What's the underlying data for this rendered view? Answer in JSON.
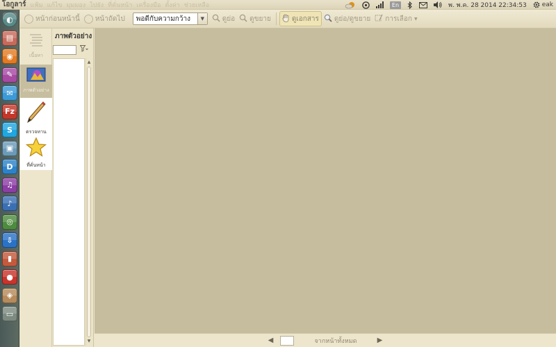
{
  "top_panel": {
    "app_title": "โอกูลาร์",
    "menus": [
      "แฟ้ม",
      "แก้ไข",
      "มุมมอง",
      "ไปยัง",
      "ที่คั่นหน้า",
      "เครื่องมือ",
      "ตั้งค่า",
      "ช่วยเหลือ"
    ],
    "keyboard_layout": "En",
    "datetime": "พ. พ.ค. 28 2014 22:34:53",
    "user": "eak"
  },
  "launcher": {
    "items": [
      {
        "icon": "dash-home-icon",
        "color": "#3d8ad1"
      },
      {
        "icon": "files-icon",
        "color": "#c76a5a"
      },
      {
        "icon": "firefox-icon",
        "color": "#e47a21"
      },
      {
        "icon": "calligra-icon",
        "color": "#a74aa3"
      },
      {
        "icon": "messenger-icon",
        "color": "#3b9ad8"
      },
      {
        "icon": "filezilla-icon",
        "color": "#c4362a"
      },
      {
        "icon": "skype-icon",
        "color": "#20a6e0"
      },
      {
        "icon": "image-viewer-icon",
        "color": "#6b9ab8"
      },
      {
        "icon": "dictionary-icon",
        "color": "#2d83c9"
      },
      {
        "icon": "audio-player-icon",
        "color": "#8b3ea4"
      },
      {
        "icon": "music-icon",
        "color": "#3b6fb3"
      },
      {
        "icon": "disk-icon",
        "color": "#4d8b3e"
      },
      {
        "icon": "downloader-icon",
        "color": "#2a72c6"
      },
      {
        "icon": "terminal-icon",
        "color": "#c45a3c"
      },
      {
        "icon": "media-icon",
        "color": "#c9342c"
      },
      {
        "icon": "okular-icon",
        "color": "#b68a5a"
      },
      {
        "icon": "trash-icon",
        "color": "#7c8a80"
      }
    ]
  },
  "toolbar": {
    "prev_label": "หน้าก่อนหน้านี้",
    "next_label": "หน้าถัดไป",
    "zoom_value": "พอดีกับความกว้าง",
    "zoom_in_label": "ดูย่อ",
    "zoom_out_label": "ดูขยาย",
    "browse_label": "ดูเอกสาร",
    "zoom_tool_label": "ดูย่อ/ดูขยาย",
    "selection_label": "การเลือก"
  },
  "sidebar": {
    "tabs": [
      {
        "label": "เนื้อหา",
        "icon": "contents-icon"
      },
      {
        "label": "ภาพตัวอย่าง",
        "icon": "thumbnails-icon"
      },
      {
        "label": "ตรวจทาน",
        "icon": "review-pencil-icon"
      },
      {
        "label": "ที่คั่นหน้า",
        "icon": "bookmark-star-icon"
      }
    ]
  },
  "thumbnails": {
    "title": "ภาพตัวอย่าง",
    "search_value": ""
  },
  "bottom_bar": {
    "page_value": "",
    "of_pages_label": "จากหน้าทั้งหมด"
  }
}
